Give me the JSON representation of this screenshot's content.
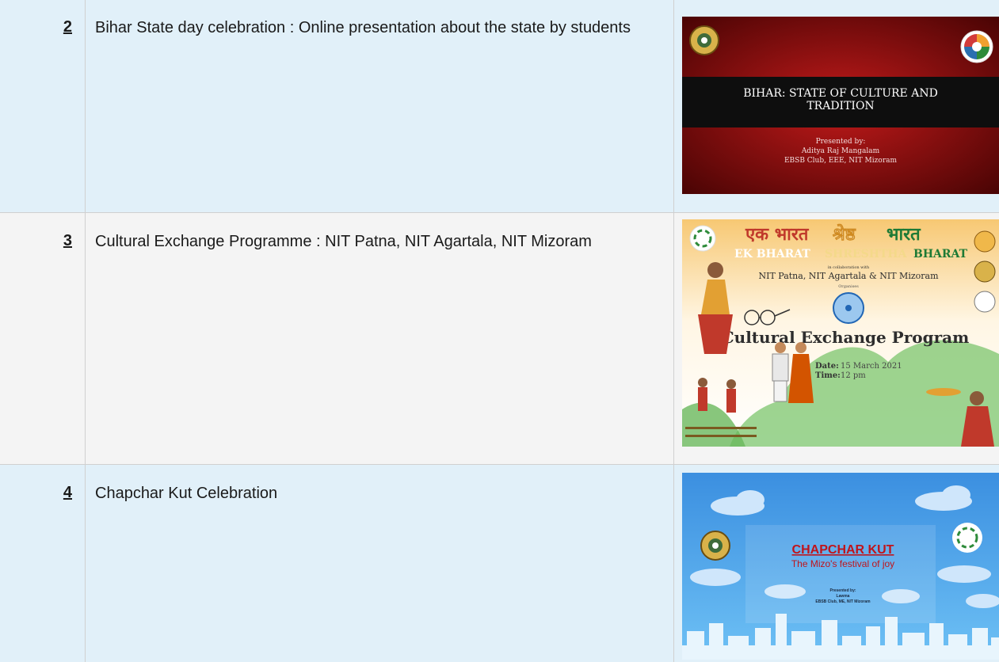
{
  "rows": [
    {
      "number": "2",
      "description": "Bihar State day celebration : Online presentation about the state by students",
      "thumbnail": {
        "title_line1": "BIHAR: STATE OF CULTURE AND",
        "title_line2": "TRADITION",
        "presented_by": "Presented by:",
        "presenter": "Aditya Raj Mangalam",
        "club": "EBSB Club, EEE, NIT Mizoram"
      }
    },
    {
      "number": "3",
      "description": "Cultural Exchange Programme : NIT Patna, NIT Agartala, NIT Mizoram",
      "thumbnail": {
        "hindi_part1": "एक भारत",
        "hindi_part2": "श्रेष्ठ",
        "hindi_part3": "भारत",
        "en_part1": "EK BHARAT",
        "en_part2": "SHRESHTHA",
        "en_part3": "BHARAT",
        "collab": "in collaboration with",
        "institutes": "NIT Patna, NIT Agartala & NIT Mizoram",
        "organises": "Organises",
        "program_title": "Cultural Exchange Program",
        "date_label": "Date:",
        "date_value": "15 March 2021",
        "time_label": "Time:",
        "time_value": "12 pm"
      }
    },
    {
      "number": "4",
      "description": "Chapchar Kut Celebration",
      "thumbnail": {
        "title": "CHAPCHAR KUT",
        "subtitle": "The Mizo's festival of joy",
        "presented_by": "Presented by:",
        "presenter": "Lawma",
        "club": "EBSB Club, ME, NIT Mizoram"
      }
    }
  ],
  "colors": {
    "row_blue": "#e1f0f9",
    "row_gray": "#f4f4f4",
    "divider": "#d0d0d0"
  }
}
